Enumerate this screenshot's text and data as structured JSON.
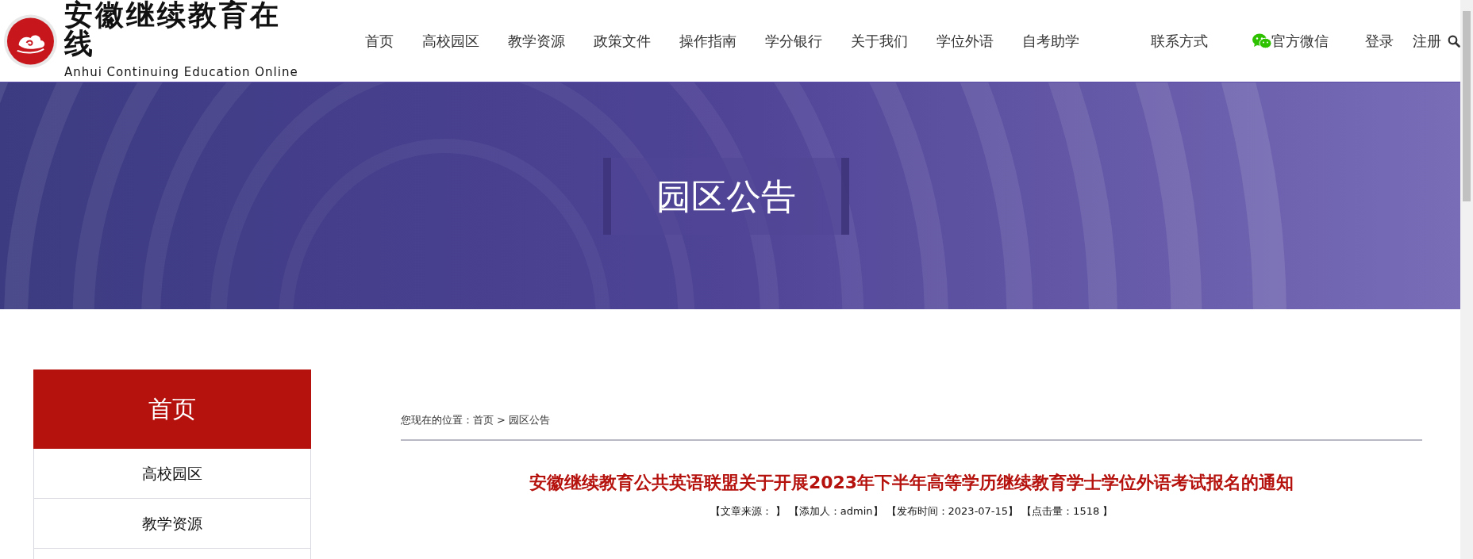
{
  "logo": {
    "title": "安徽继续教育在线",
    "subtitle": "Anhui Continuing Education Online"
  },
  "nav": {
    "items": [
      {
        "label": "首页",
        "kind": "text"
      },
      {
        "label": "高校园区",
        "kind": "text"
      },
      {
        "label": "教学资源",
        "kind": "text"
      },
      {
        "label": "政策文件",
        "kind": "text"
      },
      {
        "label": "操作指南",
        "kind": "text"
      },
      {
        "label": "学分银行",
        "kind": "text"
      },
      {
        "label": "关于我们",
        "kind": "text"
      },
      {
        "label": "学位外语",
        "kind": "text"
      },
      {
        "label": "自考助学",
        "kind": "text"
      },
      {
        "label": "联系方式",
        "kind": "text"
      },
      {
        "label": "官方微信",
        "kind": "wechat"
      }
    ],
    "login": "登录",
    "register": "注册"
  },
  "banner": {
    "title": "园区公告"
  },
  "sidebar": {
    "items": [
      {
        "label": "首页",
        "selected": true
      },
      {
        "label": "高校园区",
        "selected": false
      },
      {
        "label": "教学资源",
        "selected": false
      }
    ]
  },
  "breadcrumb": {
    "prefix": "您现在的位置：",
    "items": [
      "首页",
      "园区公告"
    ],
    "separator": ">"
  },
  "article": {
    "title": "安徽继续教育公共英语联盟关于开展2023年下半年高等学历继续教育学士学位外语考试报名的通知",
    "meta": [
      "【文章来源： 】",
      "【添加人：admin】",
      "【发布时间：2023-07-15】",
      "【点击量：1518 】"
    ]
  }
}
